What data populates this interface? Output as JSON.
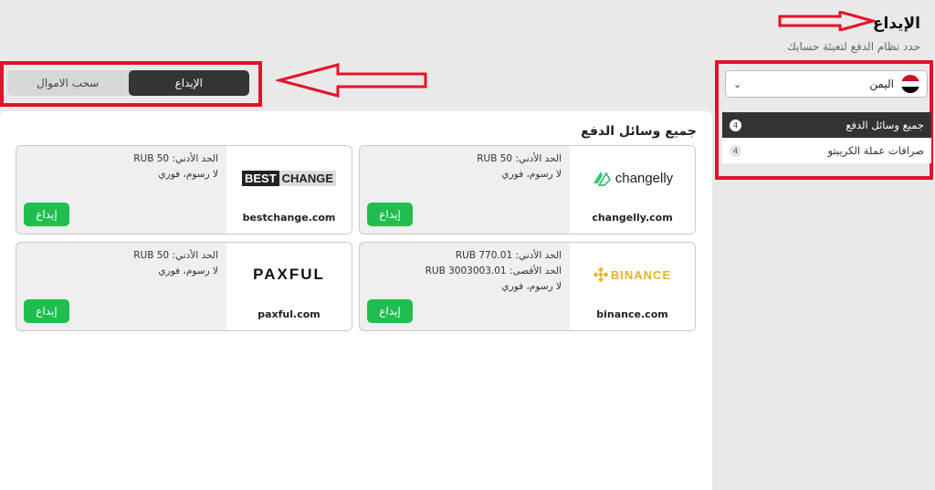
{
  "header": {
    "title": "الإيداع",
    "subtitle": "حدد نظام الدفع لتعبئة حسابك"
  },
  "tabs": [
    {
      "label": "الإيداع",
      "active": true
    },
    {
      "label": "سحب الاموال",
      "active": false
    }
  ],
  "sidebar": {
    "country": "اليمن",
    "items": [
      {
        "label": "جميع وسائل الدفع",
        "count": "4",
        "active": true
      },
      {
        "label": "صرافات عملة الكريبتو",
        "count": "4",
        "active": false
      }
    ]
  },
  "main": {
    "section_title": "جميع وسائل الدفع",
    "cards": [
      {
        "logo_icon": "changelly-logo",
        "logo_text": "changelly",
        "domain": "changelly.com",
        "lines": [
          "الحد الأدني: RUB 50",
          "لا رسوم، فوري"
        ],
        "button": "إيداع"
      },
      {
        "logo_icon": "bestchange-logo",
        "logo_text_1": "BEST",
        "logo_text_2": "CHANGE",
        "domain": "bestchange.com",
        "lines": [
          "الحد الأدني: RUB 50",
          "لا رسوم، فوري"
        ],
        "button": "إيداع"
      },
      {
        "logo_icon": "binance-logo",
        "logo_text": "BINANCE",
        "domain": "binance.com",
        "lines": [
          "الحد الأدني: RUB 770.01",
          "الحد الأقصى: RUB 3003003.01",
          "لا رسوم، فوري"
        ],
        "button": "إيداع"
      },
      {
        "logo_icon": "paxful-logo",
        "logo_text": "PAXFUL",
        "domain": "paxful.com",
        "lines": [
          "الحد الأدني: RUB 50",
          "لا رسوم، فوري"
        ],
        "button": "إيداع"
      }
    ]
  },
  "colors": {
    "annotation_red": "#e3122b",
    "deposit_green": "#1fbe4f",
    "active_dark": "#333333"
  }
}
